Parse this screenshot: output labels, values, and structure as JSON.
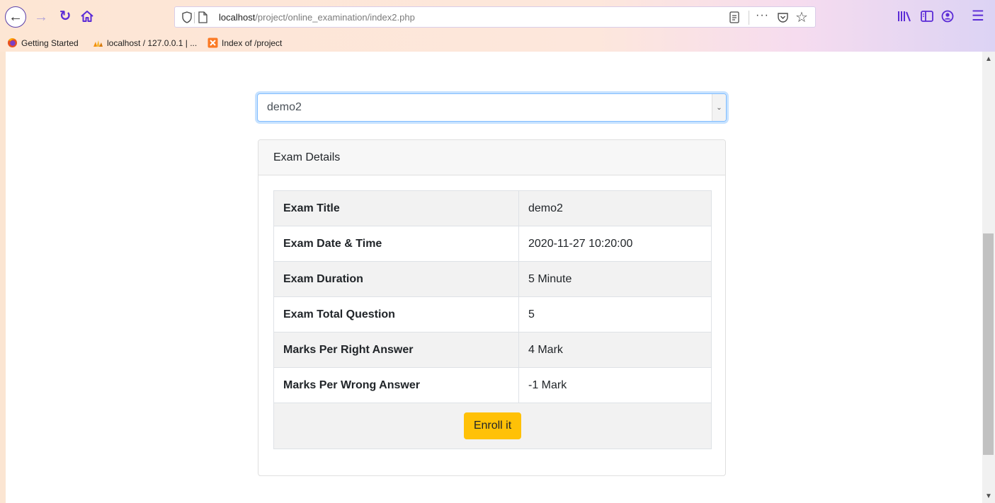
{
  "browser": {
    "url_host": "localhost",
    "url_path": "/project/online_examination/index2.php",
    "bookmarks": [
      {
        "label": "Getting Started",
        "icon": "firefox-icon"
      },
      {
        "label": "localhost / 127.0.0.1 | ...",
        "icon": "phpmyadmin-icon"
      },
      {
        "label": "Index of /project",
        "icon": "xampp-icon"
      }
    ],
    "accent_color": "#5b2bd6"
  },
  "exam_select": {
    "selected": "demo2"
  },
  "exam_details": {
    "header": "Exam Details",
    "rows": [
      {
        "label": "Exam Title",
        "value": "demo2"
      },
      {
        "label": "Exam Date & Time",
        "value": "2020-11-27 10:20:00"
      },
      {
        "label": "Exam Duration",
        "value": "5 Minute"
      },
      {
        "label": "Exam Total Question",
        "value": "5"
      },
      {
        "label": "Marks Per Right Answer",
        "value": "4 Mark"
      },
      {
        "label": "Marks Per Wrong Answer",
        "value": "-1 Mark"
      }
    ],
    "enroll_label": "Enroll it",
    "enroll_color": "#ffc107"
  }
}
